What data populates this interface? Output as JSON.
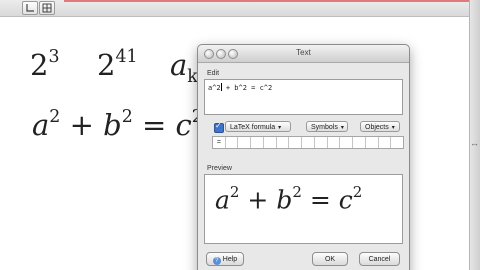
{
  "window": {
    "toolbar_buttons": [
      "axes-tool-icon",
      "grid-tool-icon"
    ]
  },
  "canvas": {
    "row1": [
      {
        "base": "2",
        "exp": "3"
      },
      {
        "base": "2",
        "exp": "41"
      },
      {
        "base": "a",
        "sub": "k"
      }
    ],
    "row2": {
      "a": "a",
      "a_exp": "2",
      "plus": "+",
      "b": "b",
      "b_exp": "2",
      "eq": "=",
      "c": "c",
      "c_exp": "2"
    }
  },
  "dialog": {
    "title": "Text",
    "edit_label": "Edit",
    "edit_value_before_caret": "a^2",
    "edit_value_after_caret": " + b^2 = c^2",
    "latex_label": "LaTeX formula",
    "latex_checked": true,
    "symbols_label": "Symbols",
    "objects_label": "Objects",
    "symbol_cells": [
      "=",
      "",
      "",
      "",
      "",
      "",
      "",
      "",
      "",
      "",
      "",
      "",
      "",
      "",
      ""
    ],
    "preview_label": "Preview",
    "preview": {
      "a": "a",
      "a_exp": "2",
      "plus": "+",
      "b": "b",
      "b_exp": "2",
      "eq": "=",
      "c": "c",
      "c_exp": "2"
    },
    "help_label": "Help",
    "ok_label": "OK",
    "cancel_label": "Cancel"
  },
  "colors": {
    "accent": "#3f74c9",
    "window_red_line": "#e07a7a"
  }
}
